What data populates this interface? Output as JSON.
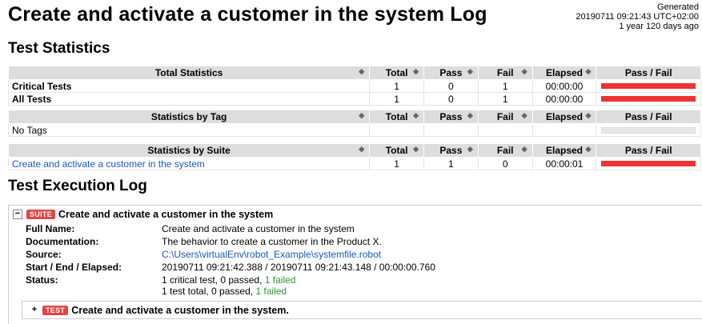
{
  "header": {
    "title": "Create and activate a customer in the system Log",
    "generated_label": "Generated",
    "generated_time": "20190711 09:21:43 UTC+02:00",
    "generated_ago": "1 year 120 days ago"
  },
  "sections": {
    "test_statistics": "Test Statistics",
    "test_execution_log": "Test Execution Log"
  },
  "columns": {
    "total": "Total",
    "pass": "Pass",
    "fail": "Fail",
    "elapsed": "Elapsed",
    "passfail": "Pass / Fail"
  },
  "total_stats": {
    "header": "Total Statistics",
    "rows": [
      {
        "name": "Critical Tests",
        "total": "1",
        "pass": "0",
        "fail": "1",
        "elapsed": "00:00:00",
        "fail_ratio": 1.0
      },
      {
        "name": "All Tests",
        "total": "1",
        "pass": "0",
        "fail": "1",
        "elapsed": "00:00:00",
        "fail_ratio": 1.0
      }
    ]
  },
  "tag_stats": {
    "header": "Statistics by Tag",
    "empty": "No Tags"
  },
  "suite_stats": {
    "header": "Statistics by Suite",
    "rows": [
      {
        "name": "Create and activate a customer in the system",
        "total": "1",
        "pass": "1",
        "fail": "0",
        "elapsed": "00:00:01",
        "fail_ratio": 1.0
      }
    ]
  },
  "suite": {
    "toggle": "−",
    "label": "SUITE",
    "name": "Create and activate a customer in the system",
    "full_name_key": "Full Name:",
    "full_name": "Create and activate a customer in the system",
    "doc_key": "Documentation:",
    "doc": "The behavior to create a customer in the Product X.",
    "source_key": "Source:",
    "source": "C:\\Users\\virtualEnv\\robot_Example\\systemfile.robot",
    "times_key": "Start / End / Elapsed:",
    "times": "20190711 09:21:42.388 / 20190711 09:21:43.148 / 00:00:00.760",
    "status_key": "Status:",
    "status_line1_prefix": "1 critical test, 0 passed, ",
    "status_line1_failed": "1 failed",
    "status_line2_prefix": "1 test total, 0 passed, ",
    "status_line2_failed": "1 failed"
  },
  "test": {
    "toggle": "+",
    "label": "TEST",
    "name": "Create and activate a customer in the system."
  },
  "colors": {
    "fail_bar": "#ee3333",
    "link": "#1a56c7",
    "status_green": "#2a9a2a",
    "label_red": "#e64444"
  }
}
